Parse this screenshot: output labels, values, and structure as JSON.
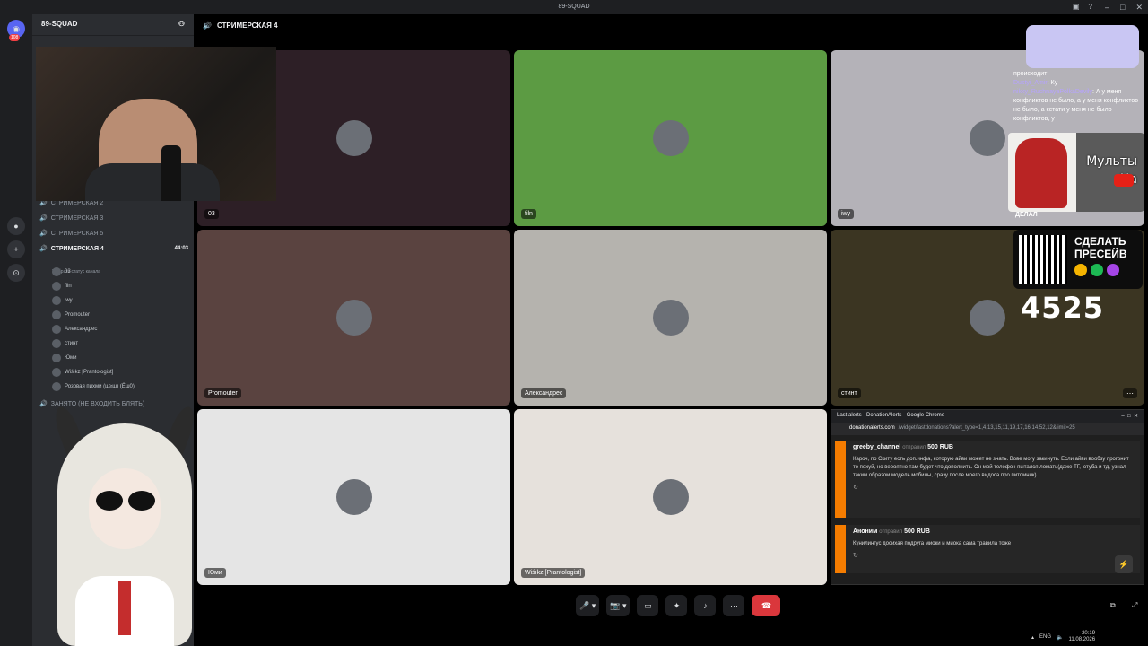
{
  "window": {
    "title": "89-SQUAD"
  },
  "servers": {
    "home_badge": "108"
  },
  "sidebar": {
    "server_name": "89-SQUAD",
    "channels": [
      {
        "name": "СТРИМЕРСКАЯ 2"
      },
      {
        "name": "СТРИМЕРСКАЯ 3"
      },
      {
        "name": "СТРИМЕРСКАЯ 5"
      },
      {
        "name": "СТРИМЕРСКАЯ 4",
        "time": "44:03",
        "status": "Выбрать статус канала"
      },
      {
        "name": "ЗАНЯТО (НЕ ВХОДИТЬ БЛЯТЬ)"
      }
    ],
    "members": [
      "03",
      "filn",
      "iwy",
      "Promouter",
      "Александрес",
      "стинт",
      "Юми",
      "Wiśıkz [Prantologist]",
      "Розовая пихми (ш≥ш) (Ëш0)"
    ]
  },
  "topbar": {
    "channel": "СТРИМЕРСКАЯ 4"
  },
  "tiles": [
    {
      "name": "03",
      "bg": "#2d1f26"
    },
    {
      "name": "filn",
      "bg": "#5c9b43"
    },
    {
      "name": "iwy",
      "bg": "#b4b2b8"
    },
    {
      "name": "Promouter",
      "bg": "#5a4340"
    },
    {
      "name": "Александрес",
      "bg": "#b5b3ae"
    },
    {
      "name": "стинт",
      "bg": "#3b3522"
    },
    {
      "name": "Юми",
      "bg": "#e5e5e5"
    },
    {
      "name": "Wiśıkz [Prantologist]",
      "bg": "#e6e1dc"
    }
  ],
  "overlay": {
    "chat": [
      {
        "nick": "",
        "text": "происходит"
      },
      {
        "nick": "Dustyi_Amir",
        "text": ": Ку"
      },
      {
        "nick": "nikky_RuchnayaPolkaDevily",
        "text": ": А у меня конфликтов не было, а у меня конфликтов не было, а кстати у меня не было конфликтов, у"
      }
    ],
    "cartoon_text_1": "Мульты",
    "cartoon_text_2": "На",
    "delal": "ДЕЛАЛ",
    "presave_1": "СДЕЛАТЬ",
    "presave_2": "ПРЕСЕЙВ",
    "counter": "4525"
  },
  "alerts_window": {
    "title": "Last alerts - DonationAlerts - Google Chrome",
    "url_host": "donationalerts.com",
    "url_path": "/widget/lastdonations?alert_type=1,4,13,15,11,19,17,16,14,52,12&limit=25",
    "donations": [
      {
        "user": "greeby_channel",
        "action": "отправил",
        "amount": "500 RUB",
        "message": "Кароч, по Скиту есть доп.инфа, которую айви может не знать. Вове могу закинуть. Если айви вообзу прогонит то похуй, но вероятно там будет что дополнить. Он мой телефон пытался ломать(даже ТГ, ютуба и тд, узнал таким образом модель мобилы, сразу после моего видоса про питомник)"
      },
      {
        "user": "Аноним",
        "action": "отправил",
        "amount": "500 RUB",
        "message": "Кунилингус досихая подруга миоки и миока сама травила тоже"
      }
    ]
  },
  "taskbar": {
    "lang": "ENG",
    "time": "20:19",
    "date": "11.08.2026"
  }
}
